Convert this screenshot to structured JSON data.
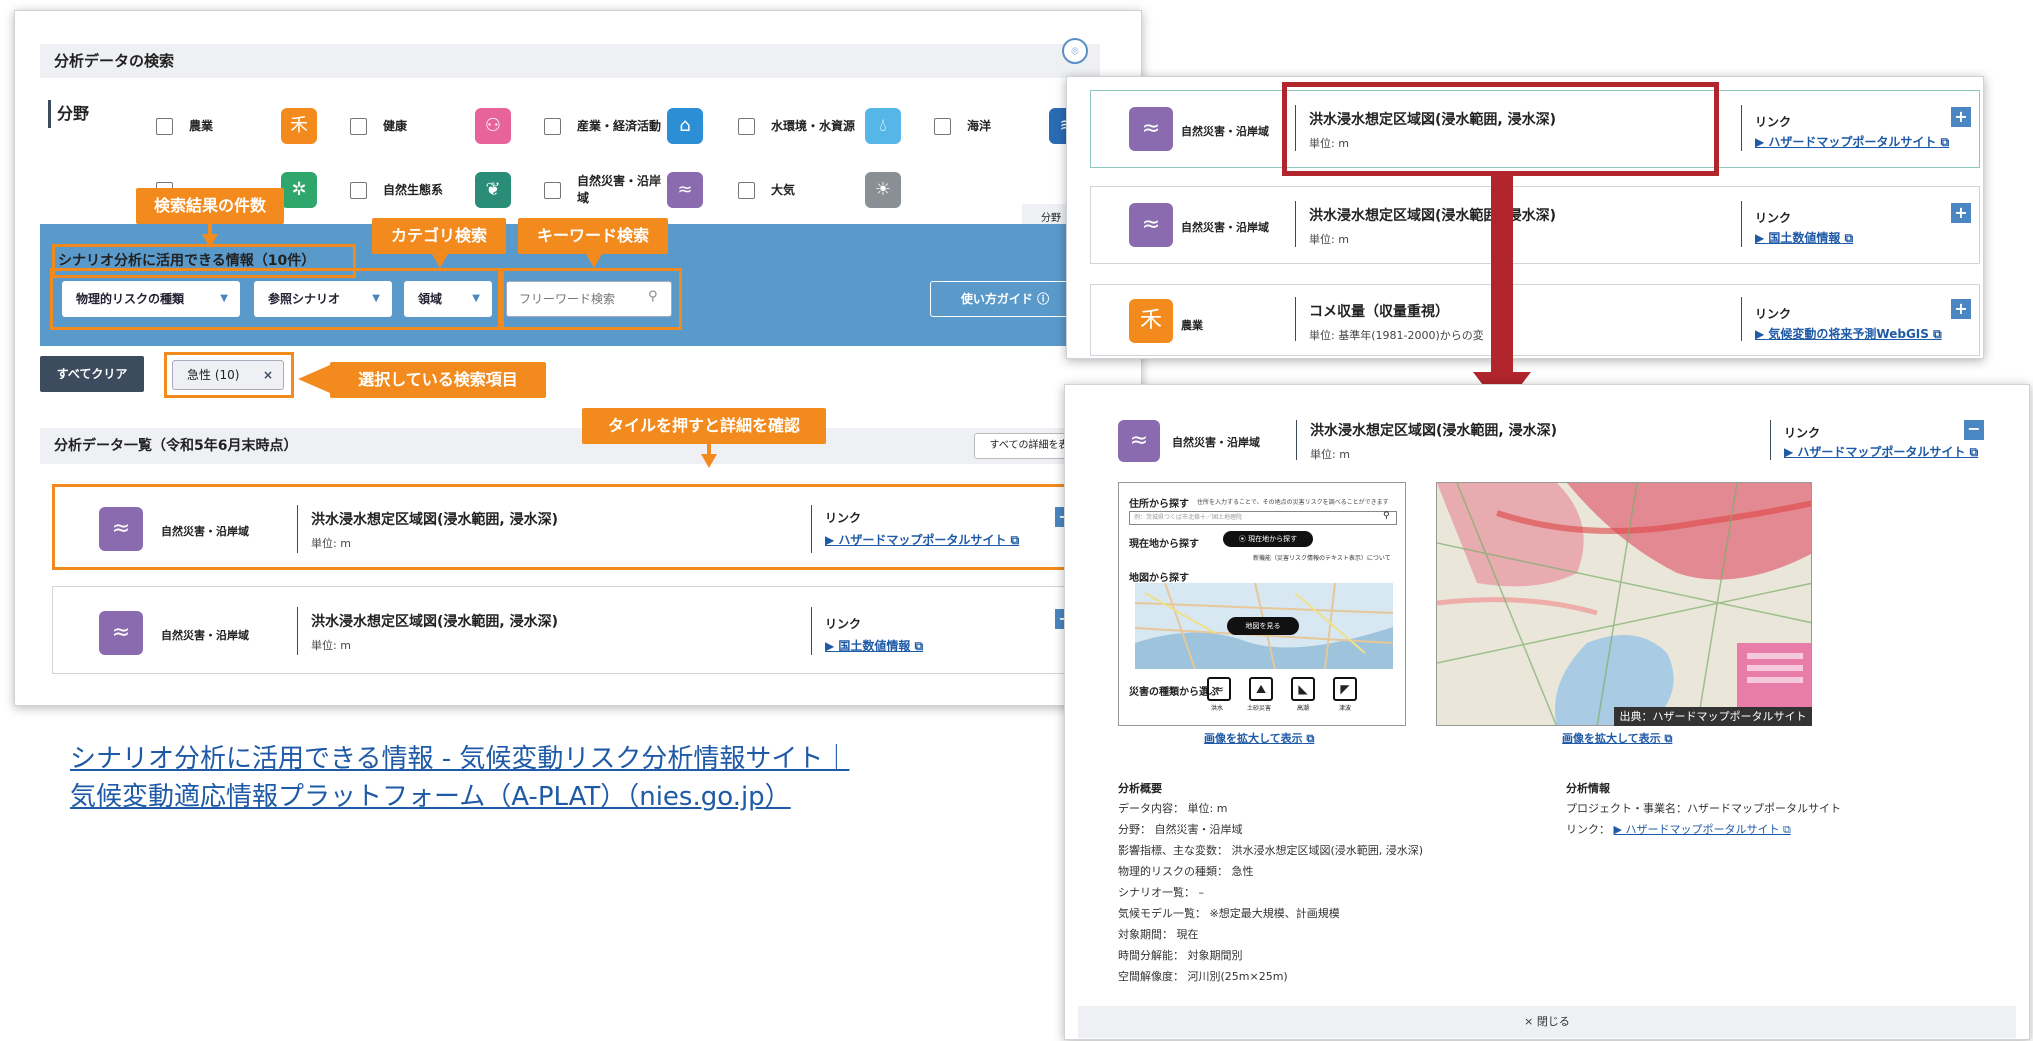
{
  "search": {
    "title": "分析データの検索",
    "field_label": "分野",
    "categories": [
      {
        "label": "農業"
      },
      {
        "label": "健康"
      },
      {
        "label": "産業・経済活動"
      },
      {
        "label": "水環境・水資源"
      },
      {
        "label": "海洋"
      },
      {
        "label": "自然生態系"
      },
      {
        "label": "自然災害・沿岸域"
      },
      {
        "label": "大気"
      }
    ],
    "side_tab": "分野"
  },
  "scenario": {
    "title": "シナリオ分析に活用できる情報（10件）",
    "dropdowns": [
      "物理的リスクの種類",
      "参照シナリオ",
      "領域"
    ],
    "search_placeholder": "フリーワード検索",
    "guide_button": "使い方ガイド ⓘ"
  },
  "callouts": {
    "result_count": "検索結果の件数",
    "category_search": "カテゴリ検索",
    "keyword_search": "キーワード検索",
    "selected_items": "選択している検索項目",
    "tile_detail": "タイルを押すと詳細を確認"
  },
  "filters": {
    "clear_all": "すべてクリア",
    "chip": "急性 (10)",
    "chip_close": "×"
  },
  "list": {
    "header": "分析データ一覧（令和5年6月末時点）",
    "show_all": "すべての詳細を表",
    "link_label": "リンク",
    "tiles": [
      {
        "category": "自然災害・沿岸域",
        "title": "洪水浸水想定区域図(浸水範囲, 浸水深)",
        "unit": "単位: m",
        "link": "ハザードマップポータルサイト"
      },
      {
        "category": "自然災害・沿岸域",
        "title": "洪水浸水想定区域図(浸水範囲, 浸水深)",
        "unit": "単位: m",
        "link": "国土数値情報"
      }
    ]
  },
  "caption": {
    "line1": "シナリオ分析に活用できる情報 - 気候変動リスク分析情報サイト｜",
    "line2": "気候変動適応情報プラットフォーム（A-PLAT）（nies.go.jp）"
  },
  "right_top": {
    "tiles": [
      {
        "category": "自然災害・沿岸域",
        "title": "洪水浸水想定区域図(浸水範囲, 浸水深)",
        "unit": "単位: m",
        "link": "ハザードマップポータルサイト"
      },
      {
        "category": "自然災害・沿岸域",
        "title": "洪水浸水想定区域図(浸水範囲, 浸水深)",
        "unit": "単位: m",
        "link": "国土数値情報"
      },
      {
        "category": "農業",
        "title": "コメ収量（収量重視）",
        "unit": "単位: 基準年(1981-2000)からの変",
        "link": "気候変動の将来予測WebGIS"
      }
    ]
  },
  "detail": {
    "category": "自然災害・沿岸域",
    "title": "洪水浸水想定区域図(浸水範囲, 浸水深)",
    "unit": "単位: m",
    "link_label": "リンク",
    "link": "ハザードマップポータルサイト",
    "screenshot": {
      "address_search": "住所から探す",
      "address_note": "住所を入力することで、その地点の災害リスクを調べることができます",
      "address_placeholder": "例：茨城県つくば市北條十／国土地理院",
      "current_location": "現在地から探す",
      "current_btn": "⦿ 現在地から探す",
      "new_feature": "新機能（災害リスク情報のテキスト表示）について",
      "map_search": "地図から探す",
      "view_map": "地図を見る",
      "disaster_select": "災害の種類から選ぶ",
      "disaster_types": [
        "洪水",
        "土砂災害",
        "高潮",
        "津波"
      ]
    },
    "map_credit": "出典：ハザードマップポータルサイト",
    "enlarge": "画像を拡大して表示",
    "overview_title": "分析概要",
    "overview": [
      "データ内容： 単位: m",
      "分野： 自然災害・沿岸域",
      "影響指標、主な変数： 洪水浸水想定区域図(浸水範囲, 浸水深)",
      "物理的リスクの種類： 急性",
      "シナリオ一覧： –",
      "気候モデル一覧： ※想定最大規模、計画規模",
      "対象期間： 現在",
      "時間分解能： 対象期間別",
      "空間解像度： 河川別(25m×25m)"
    ],
    "info_title": "分析情報",
    "info": {
      "project": "プロジェクト・事業名：ハザードマップポータルサイト",
      "link_prefix": "リンク：",
      "link": "ハザードマップポータルサイト"
    },
    "close": "× 閉じる"
  },
  "colors": {
    "accent_orange": "#f28a1e",
    "header_blue": "#5a9acb",
    "dark_navy": "#3c4b5e",
    "highlight_red": "#b0262c",
    "link_blue": "#1f5aa6"
  }
}
